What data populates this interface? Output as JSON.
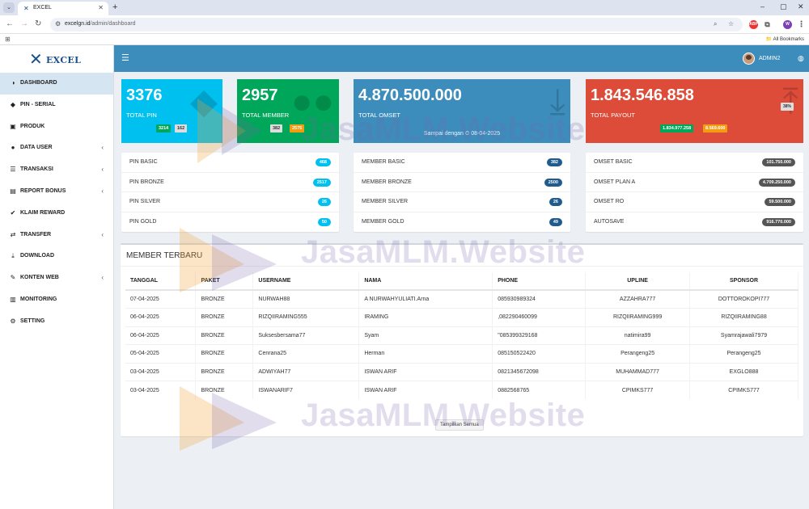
{
  "browser": {
    "tab_title": "EXCEL",
    "url_domain": "excelgn.id",
    "url_path": "/admin/dashboard",
    "all_bookmarks": "All Bookmarks",
    "profile_initial": "W"
  },
  "sidebar": {
    "logo_text": "EXCEL",
    "items": [
      {
        "label": "DASHBOARD",
        "icon": "dashboard-icon",
        "glyph": "◑",
        "active": true,
        "caret": ""
      },
      {
        "label": "PIN - SERIAL",
        "icon": "tag-icon",
        "glyph": "◆",
        "active": false,
        "caret": ""
      },
      {
        "label": "PRODUK",
        "icon": "box-icon",
        "glyph": "▣",
        "active": false,
        "caret": ""
      },
      {
        "label": "DATA USER",
        "icon": "users-icon",
        "glyph": "●",
        "active": false,
        "caret": "‹"
      },
      {
        "label": "TRANSAKSI",
        "icon": "list-icon",
        "glyph": "☰",
        "active": false,
        "caret": "‹"
      },
      {
        "label": "REPORT BONUS",
        "icon": "money-icon",
        "glyph": "▤",
        "active": false,
        "caret": "‹"
      },
      {
        "label": "KLAIM REWARD",
        "icon": "check-icon",
        "glyph": "✔",
        "active": false,
        "caret": ""
      },
      {
        "label": "TRANSFER",
        "icon": "exchange-icon",
        "glyph": "⇄",
        "active": false,
        "caret": "‹"
      },
      {
        "label": "DOWNLOAD",
        "icon": "download-icon",
        "glyph": "⤓",
        "active": false,
        "caret": ""
      },
      {
        "label": "KONTEN WEB",
        "icon": "edit-icon",
        "glyph": "✎",
        "active": false,
        "caret": "‹"
      },
      {
        "label": "MONITORING",
        "icon": "bar-chart-icon",
        "glyph": "▥",
        "active": false,
        "caret": ""
      },
      {
        "label": "SETTING",
        "icon": "gears-icon",
        "glyph": "⚙",
        "active": false,
        "caret": ""
      }
    ]
  },
  "header": {
    "user_name": "ADMIN2"
  },
  "stats": {
    "pin": {
      "value": "3376",
      "label": "TOTAL PIN",
      "chip1": "3214",
      "chip2": "162",
      "color": "#00c0ef"
    },
    "member": {
      "value": "2957",
      "label": "TOTAL MEMBER",
      "chip1": "382",
      "chip2": "2575",
      "color": "#00a65a"
    },
    "omset": {
      "value": "4.870.500.000",
      "label": "TOTAL OMSET",
      "footer": "Sampai dengan ⏲ 08-04-2025",
      "color": "#3c8dbc"
    },
    "payout": {
      "value": "1.843.546.858",
      "label": "TOTAL PAYOUT",
      "percent": "38%",
      "chip1": "1.834.977.258",
      "chip2": "8.569.600",
      "color": "#dd4b39"
    }
  },
  "pins": [
    {
      "label": "PIN BASIC",
      "value": "468"
    },
    {
      "label": "PIN BRONZE",
      "value": "2517"
    },
    {
      "label": "PIN SILVER",
      "value": "26"
    },
    {
      "label": "PIN GOLD",
      "value": "50"
    }
  ],
  "members": [
    {
      "label": "MEMBER BASIC",
      "value": "382"
    },
    {
      "label": "MEMBER BRONZE",
      "value": "2500"
    },
    {
      "label": "MEMBER SILVER",
      "value": "26"
    },
    {
      "label": "MEMBER GOLD",
      "value": "49"
    }
  ],
  "omsets": [
    {
      "label": "OMSET BASIC",
      "value": "101.750.000"
    },
    {
      "label": "OMSET PLAN A",
      "value": "4.709.250.000"
    },
    {
      "label": "OMSET RO",
      "value": "59.500.000"
    },
    {
      "label": "AUTOSAVE",
      "value": "916.770.000"
    }
  ],
  "latest": {
    "title": "MEMBER TERBARU",
    "headers": [
      "TANGGAL",
      "PAKET",
      "USERNAME",
      "NAMA",
      "PHONE",
      "UPLINE",
      "SPONSOR"
    ],
    "rows": [
      [
        "07-04-2025",
        "BRONZE",
        "NURWAH88",
        "A NURWAHYULIATI.Arna",
        "085930989324",
        "AZZAHRA777",
        "DOTTOROKOPI777"
      ],
      [
        "06-04-2025",
        "BRONZE",
        "RIZQIIRAMING555",
        "IRAMING",
        ",082290460099",
        "RIZQIIRAMING999",
        "RIZQIIRAMING88"
      ],
      [
        "06-04-2025",
        "BRONZE",
        "Suksesbersama77",
        "Syam",
        "\"085399329168",
        "natimira99",
        "Syamrajawali7979"
      ],
      [
        "05-04-2025",
        "BRONZE",
        "Cenrana25",
        "Herman",
        "085150522420",
        "Perangeng25",
        "Perangeng25"
      ],
      [
        "03-04-2025",
        "BRONZE",
        "ADWIYAH77",
        "ISWAN ARIF",
        "0821345672098",
        "MUHAMMAD777",
        "EXGLO888"
      ],
      [
        "03-04-2025",
        "BRONZE",
        "ISWANARIF7",
        "ISWAN ARIF",
        "0882568765",
        "CPIMKS777",
        "CPIMKS777"
      ]
    ],
    "show_all": "Tampilkan Semua"
  },
  "watermark": "JasaMLM.Website"
}
